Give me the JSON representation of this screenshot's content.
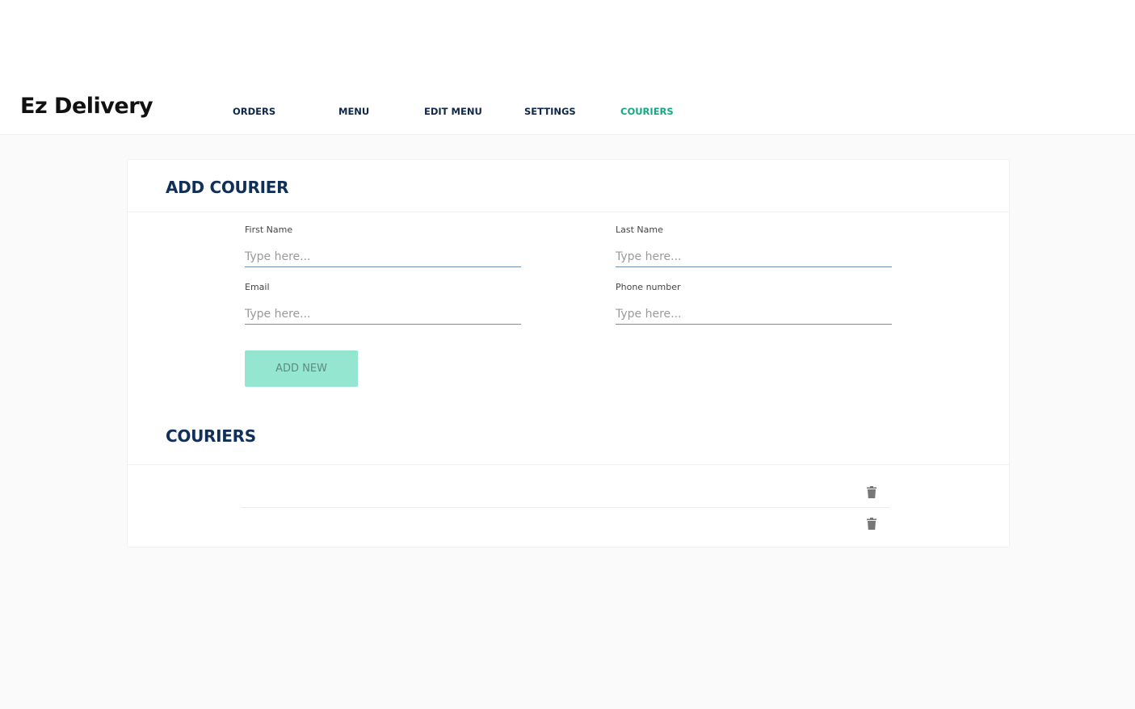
{
  "brand": "Ez Delivery",
  "nav": [
    {
      "label": "ORDERS"
    },
    {
      "label": "MENU"
    },
    {
      "label": "EDIT MENU"
    },
    {
      "label": "SETTINGS"
    },
    {
      "label": "COURIERS",
      "active": true
    }
  ],
  "add_courier": {
    "title": "ADD COURIER",
    "fields": [
      {
        "label": "First Name",
        "placeholder": "Type here...",
        "value": ""
      },
      {
        "label": "Last Name",
        "placeholder": "Type here...",
        "value": ""
      },
      {
        "label": "Email",
        "placeholder": "Type here...",
        "value": ""
      },
      {
        "label": "Phone number",
        "placeholder": "Type here...",
        "value": ""
      }
    ],
    "submit_label": "ADD NEW"
  },
  "couriers": {
    "title": "COURIERS",
    "rows": [
      {
        "icon": "trash-icon"
      },
      {
        "icon": "trash-icon"
      }
    ]
  },
  "colors": {
    "accent": "#16a981",
    "title": "#10305a",
    "button_bg": "#95e6d1",
    "page_bg": "#fafafa"
  }
}
